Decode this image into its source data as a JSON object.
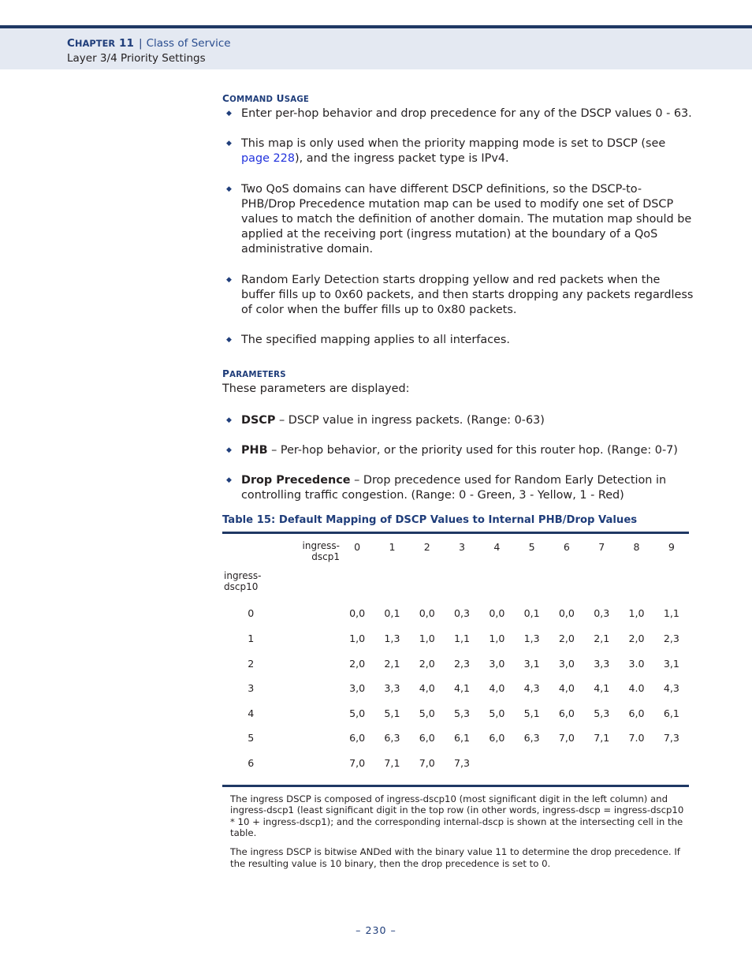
{
  "header": {
    "chapter_prefix": "C",
    "chapter_small": "HAPTER",
    "chapter_number": " 11",
    "separator": "|",
    "section": "Class of Service",
    "subsection": "Layer 3/4 Priority Settings"
  },
  "command_usage": {
    "heading_cap": "C",
    "heading_small_1": "OMMAND",
    "heading_cap2": " U",
    "heading_small_2": "SAGE",
    "bullets": [
      "Enter per-hop behavior and drop precedence for any of the DSCP values 0 - 63.",
      {
        "part1": "This map is only used when the priority mapping mode is set to DSCP (see ",
        "link": "page 228",
        "part2": "), and the ingress packet type is IPv4."
      },
      "Two QoS domains can have different DSCP definitions, so the DSCP-to-PHB/Drop Precedence mutation map can be used to modify one set of DSCP values to match the definition of another domain. The mutation map should be applied at the receiving port (ingress mutation) at the boundary of a QoS administrative domain.",
      "Random Early Detection starts dropping yellow and red packets when the buffer fills up to 0x60 packets, and then starts dropping any packets regardless of color when the buffer fills up to 0x80 packets.",
      "The specified mapping applies to all interfaces."
    ]
  },
  "parameters": {
    "heading_cap": "P",
    "heading_small": "ARAMETERS",
    "intro": "These parameters are displayed:",
    "items": [
      {
        "term": "DSCP",
        "desc": " – DSCP value in ingress packets. (Range: 0-63)"
      },
      {
        "term": "PHB",
        "desc": " – Per-hop behavior, or the priority used for this router hop. (Range: 0-7)"
      },
      {
        "term": "Drop Precedence",
        "desc": " – Drop precedence used for Random Early Detection in controlling traffic congestion. (Range: 0 - Green, 3 - Yellow, 1 - Red)"
      }
    ]
  },
  "table": {
    "title": "Table 15: Default Mapping of DSCP Values to Internal PHB/Drop Values",
    "col_axis_label_line1": "ingress-",
    "col_axis_label_line2": "dscp1",
    "row_axis_label_line1": "ingress-",
    "row_axis_label_line2": "dscp10",
    "columns": [
      "0",
      "1",
      "2",
      "3",
      "4",
      "5",
      "6",
      "7",
      "8",
      "9"
    ],
    "rows": [
      {
        "label": "0",
        "cells": [
          "0,0",
          "0,1",
          "0,0",
          "0,3",
          "0,0",
          "0,1",
          "0,0",
          "0,3",
          "1,0",
          "1,1"
        ]
      },
      {
        "label": "1",
        "cells": [
          "1,0",
          "1,3",
          "1,0",
          "1,1",
          "1,0",
          "1,3",
          "2,0",
          "2,1",
          "2,0",
          "2,3"
        ]
      },
      {
        "label": "2",
        "cells": [
          "2,0",
          "2,1",
          "2,0",
          "2,3",
          "3,0",
          "3,1",
          "3,0",
          "3,3",
          "3.0",
          "3,1"
        ]
      },
      {
        "label": "3",
        "cells": [
          "3,0",
          "3,3",
          "4,0",
          "4,1",
          "4,0",
          "4,3",
          "4,0",
          "4,1",
          "4.0",
          "4,3"
        ]
      },
      {
        "label": "4",
        "cells": [
          "5,0",
          "5,1",
          "5,0",
          "5,3",
          "5,0",
          "5,1",
          "6,0",
          "5,3",
          "6,0",
          "6,1"
        ]
      },
      {
        "label": "5",
        "cells": [
          "6,0",
          "6,3",
          "6,0",
          "6,1",
          "6,0",
          "6,3",
          "7,0",
          "7,1",
          "7.0",
          "7,3"
        ]
      },
      {
        "label": "6",
        "cells": [
          "7,0",
          "7,1",
          "7,0",
          "7,3",
          "",
          "",
          "",
          "",
          "",
          ""
        ]
      }
    ],
    "footnotes": [
      "The ingress DSCP is composed of ingress-dscp10 (most significant digit in the left column) and ingress-dscp1 (least significant digit in the top row (in other words, ingress-dscp = ingress-dscp10 * 10 + ingress-dscp1); and the corresponding internal-dscp is shown at the intersecting cell in the table.",
      "The ingress DSCP is bitwise ANDed with the binary value 11 to determine the drop precedence. If the resulting value is 10 binary, then the drop precedence is set to 0."
    ]
  },
  "footer": {
    "page_number": "–  230  –"
  },
  "colors": {
    "heading_navy": "#1f3d7a",
    "rule_navy": "#1f3864",
    "header_band": "#e4e9f2",
    "link_blue": "#2233dd",
    "body_text": "#231f20"
  }
}
